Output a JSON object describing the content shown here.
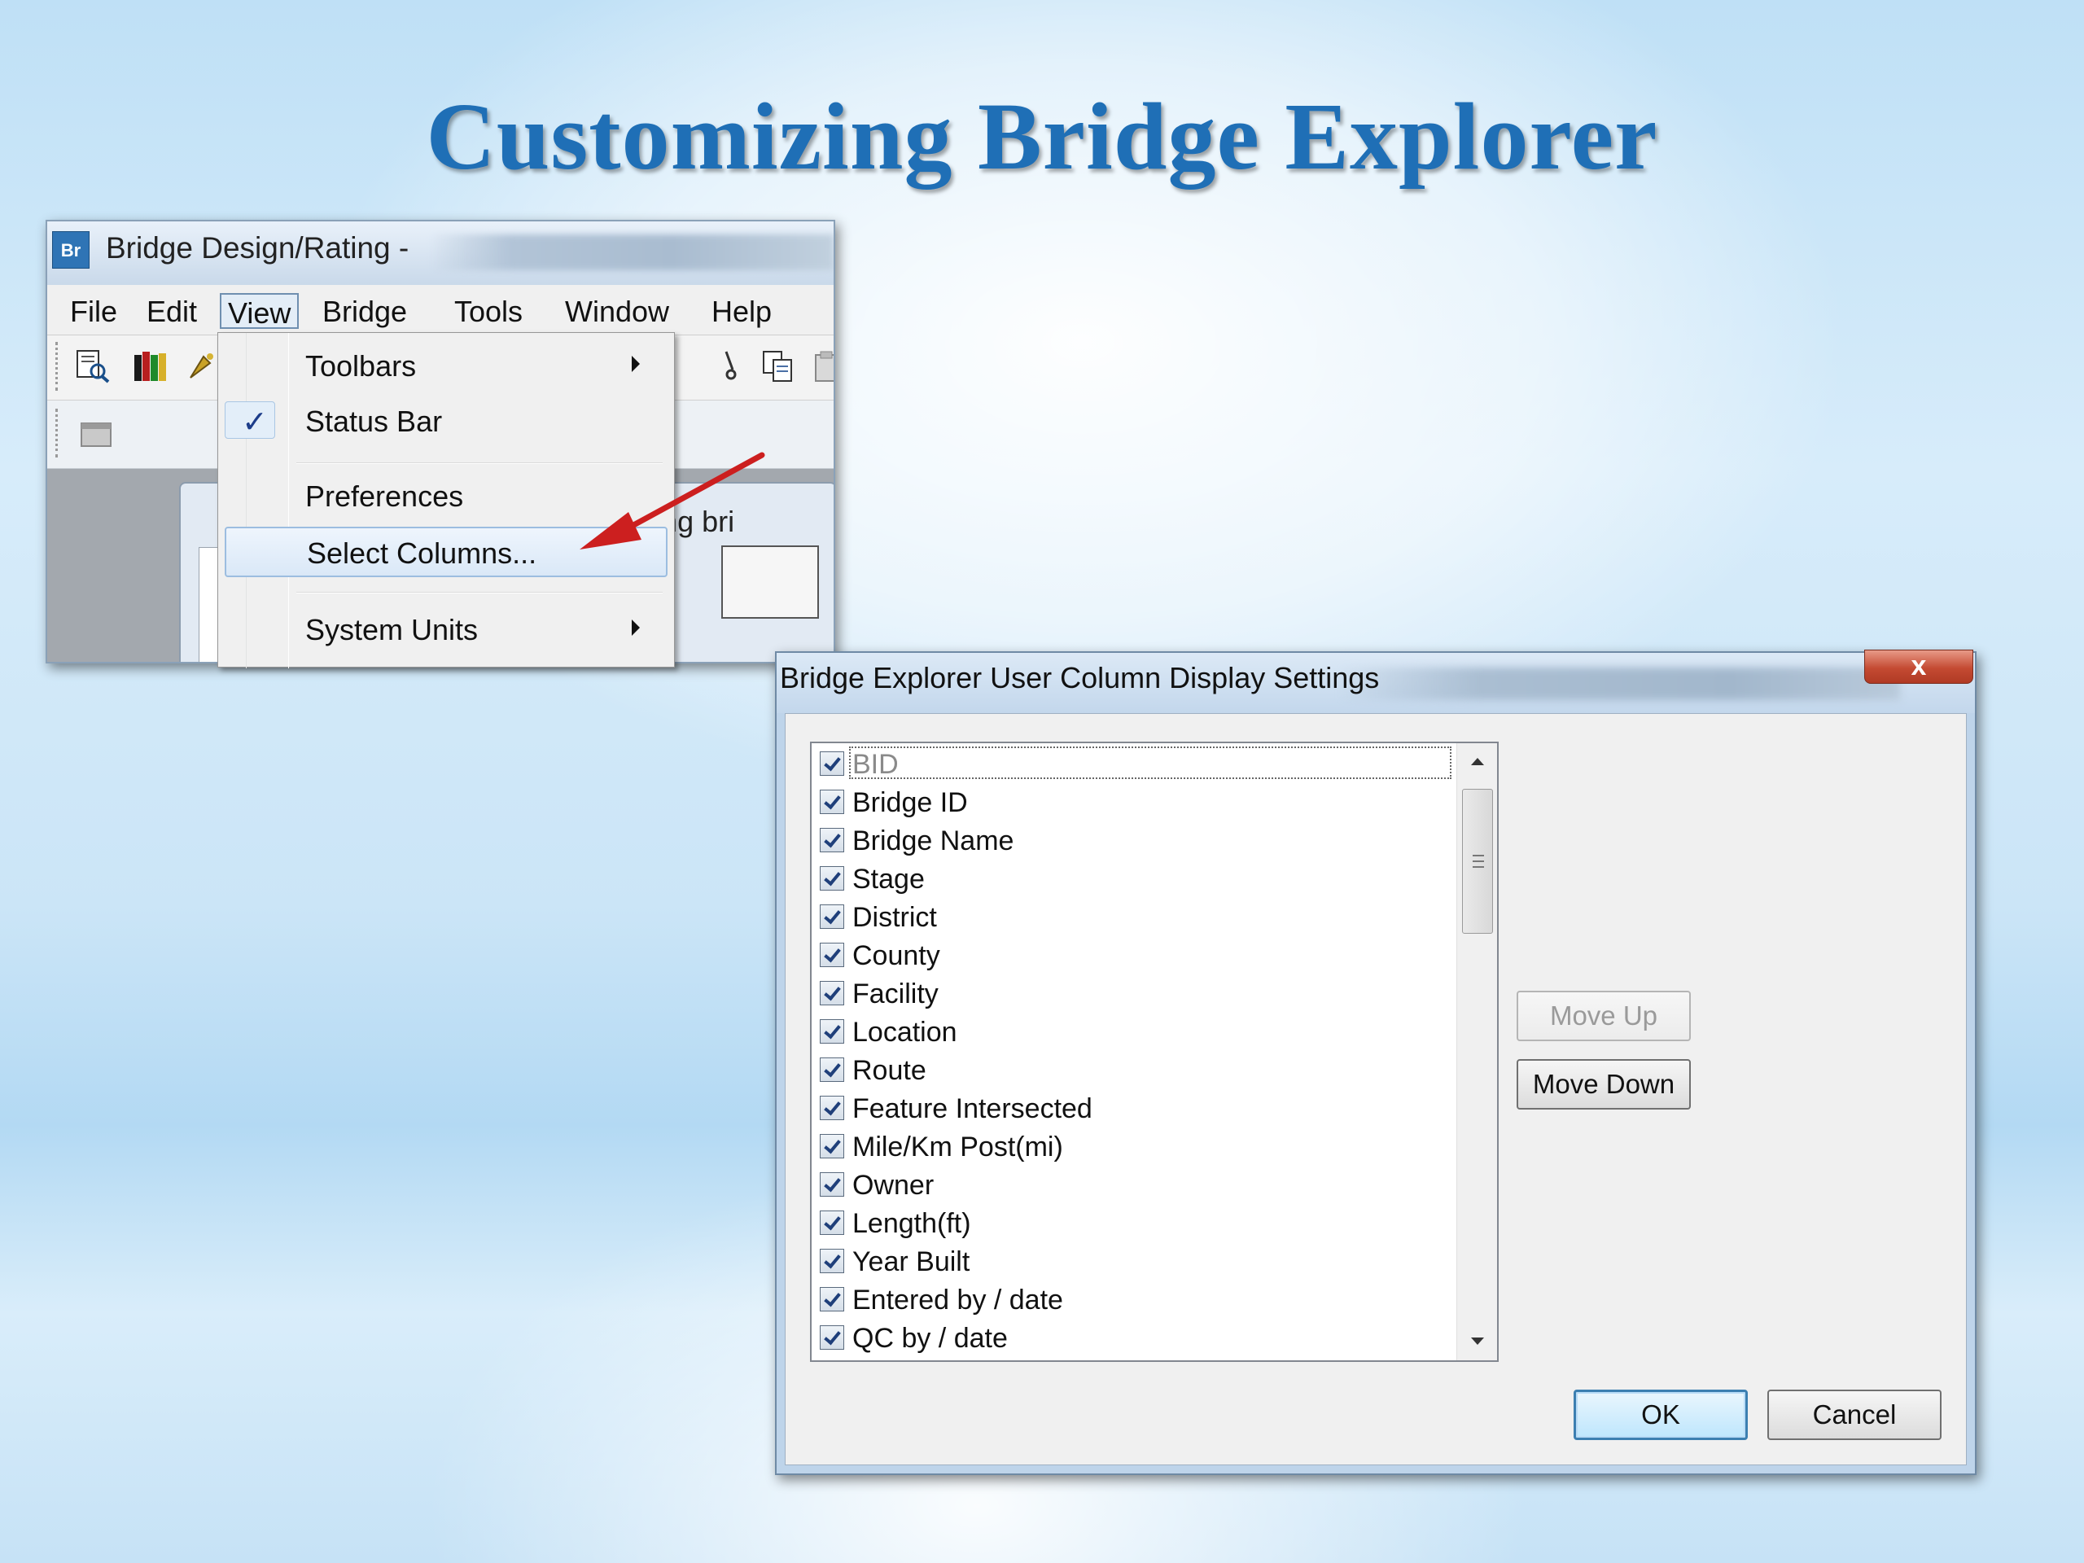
{
  "slide": {
    "title": "Customizing Bridge Explorer"
  },
  "app_window": {
    "title": "Bridge Design/Rating -",
    "icon_label": "Br",
    "menu": [
      "File",
      "Edit",
      "View",
      "Bridge",
      "Tools",
      "Window",
      "Help"
    ],
    "active_menu": "View",
    "child_window_title": "n/Rating bri",
    "toolbar_icons": [
      "find-icon",
      "library-icon",
      "wizard-icon",
      "cut-icon",
      "copy-icon",
      "paste-icon"
    ]
  },
  "view_menu": {
    "items": {
      "toolbars": "Toolbars",
      "status_bar": "Status Bar",
      "preferences": "Preferences",
      "select_columns": "Select Columns...",
      "system_units": "System Units"
    },
    "checked": "Status Bar",
    "highlighted": "Select Columns..."
  },
  "dialog": {
    "title": "Bridge Explorer User Column Display Settings",
    "close_label": "x",
    "columns": [
      {
        "label": "BID",
        "checked": true,
        "enabled": false
      },
      {
        "label": "Bridge ID",
        "checked": true
      },
      {
        "label": "Bridge Name",
        "checked": true
      },
      {
        "label": "Stage",
        "checked": true
      },
      {
        "label": "District",
        "checked": true
      },
      {
        "label": "County",
        "checked": true
      },
      {
        "label": "Facility",
        "checked": true
      },
      {
        "label": "Location",
        "checked": true
      },
      {
        "label": "Route",
        "checked": true
      },
      {
        "label": "Feature Intersected",
        "checked": true
      },
      {
        "label": "Mile/Km Post(mi)",
        "checked": true
      },
      {
        "label": "Owner",
        "checked": true
      },
      {
        "label": "Length(ft)",
        "checked": true
      },
      {
        "label": "Year Built",
        "checked": true
      },
      {
        "label": "Entered by / date",
        "checked": true
      },
      {
        "label": "QC by / date",
        "checked": true
      }
    ],
    "buttons": {
      "move_up": "Move Up",
      "move_down": "Move Down",
      "ok": "OK",
      "cancel": "Cancel"
    }
  },
  "colors": {
    "title": "#1f6fb6",
    "annotation_arrow": "#cc1f1f",
    "menu_highlight": "#dae8f7",
    "close_button": "#c44a32"
  }
}
